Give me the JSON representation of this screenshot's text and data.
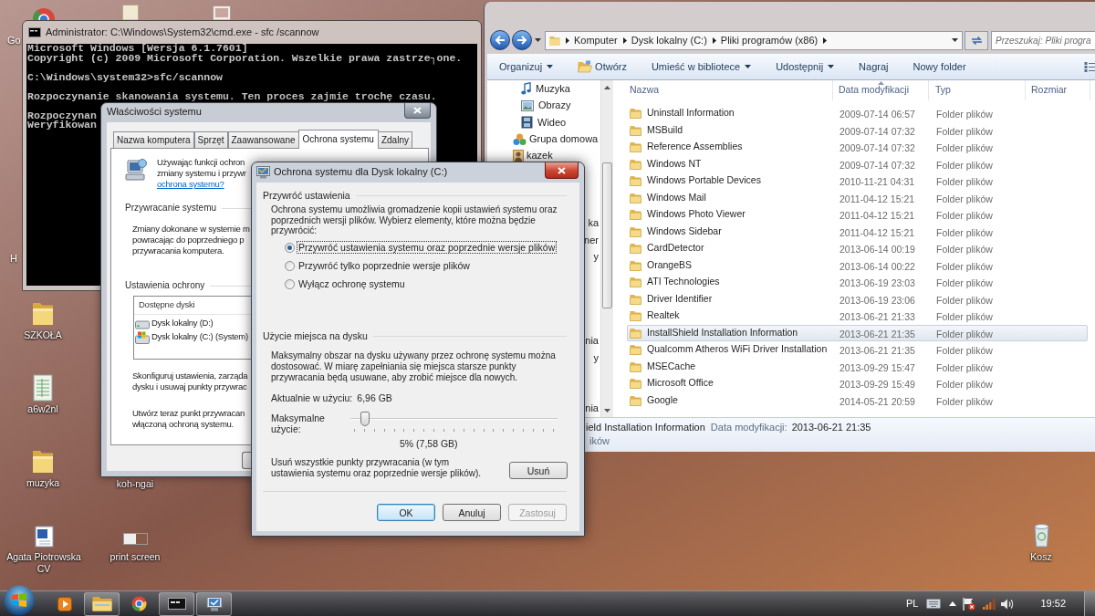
{
  "console": {
    "title": "Administrator: C:\\Windows\\System32\\cmd.exe - sfc /scannow",
    "blocks": [
      [
        "Microsoft Windows [Wersja 6.1.7601]",
        "Copyright (c) 2009 Microsoft Corporation. Wszelkie prawa zastrze┐one."
      ],
      [
        "C:\\Windows\\system32>sfc/scannow"
      ],
      [
        "Rozpoczynanie skanowania systemu. Ten proces zajmie trochę czasu."
      ],
      [
        "Rozpoczynan",
        "Weryfikowan"
      ]
    ]
  },
  "system_properties": {
    "title": "Właściwości systemu",
    "tabs": [
      {
        "label": "Nazwa komputera",
        "selected": false
      },
      {
        "label": "Sprzęt",
        "selected": false
      },
      {
        "label": "Zaawansowane",
        "selected": false
      },
      {
        "label": "Ochrona systemu",
        "selected": true
      },
      {
        "label": "Zdalny",
        "selected": false
      }
    ],
    "intro": [
      "Używając funkcji ochron",
      "zmiany systemu i przywr"
    ],
    "help_link": "ochrona systemu?",
    "sections": [
      {
        "heading": "Przywracanie systemu",
        "paragraphs": [
          [
            "Zmiany dokonane w systemie m",
            "powracając do poprzedniego p",
            "przywracania komputera."
          ]
        ]
      },
      {
        "heading": "Ustawienia ochrony",
        "drives": {
          "column": "Dostępne dyski",
          "rows": [
            {
              "name": "Dysk lokalny (D:)",
              "kind": "drive"
            },
            {
              "name": "Dysk lokalny (C:) (System)",
              "kind": "system_drive"
            }
          ]
        },
        "paragraphs": [
          [
            "Skonfiguruj ustawienia, zarząda",
            "dysku i usuwaj punkty przywrac"
          ],
          [
            "Utwórz teraz punkt przywracan",
            "włączoną ochroną systemu."
          ]
        ]
      }
    ]
  },
  "protection_dialog": {
    "title": "Ochrona systemu dla Dysk lokalny (C:)",
    "restore": {
      "heading": "Przywróć ustawienia",
      "text": "Ochrona systemu umożliwia gromadzenie kopii ustawień systemu oraz poprzednich wersji plików. Wybierz elementy, które można będzie przywrócić:",
      "options": [
        {
          "label": "Przywróć ustawienia systemu oraz poprzednie wersje plików",
          "selected": true,
          "focused": true
        },
        {
          "label": "Przywróć tylko poprzednie wersje plików",
          "selected": false,
          "focused": false
        },
        {
          "label": "Wyłącz ochronę systemu",
          "selected": false,
          "focused": false
        }
      ]
    },
    "disk_usage": {
      "heading": "Użycie miejsca na dysku",
      "text": "Maksymalny obszar na dysku używany przez ochronę systemu można dostosować. W miarę zapełniania się miejsca starsze punkty przywracania będą usuwane, aby zrobić miejsce dla nowych.",
      "current_label": "Aktualnie w użyciu:",
      "current_value": "6,96 GB",
      "max_label": "Maksymalne użycie:",
      "max_usage": {
        "level": 0.05
      },
      "max_reading": "5% (7,58 GB)",
      "delete_text": "Usuń wszystkie punkty przywracania (w tym ustawienia systemu oraz poprzednie wersje plików).",
      "delete_button": "Usuń"
    },
    "buttons": [
      {
        "label": "OK",
        "default": true,
        "disabled": false
      },
      {
        "label": "Anuluj",
        "default": false,
        "disabled": false
      },
      {
        "label": "Zastosuj",
        "default": false,
        "disabled": true
      }
    ]
  },
  "explorer": {
    "address": [
      "Komputer",
      "Dysk lokalny (C:)",
      "Pliki programów (x86)"
    ],
    "search_placeholder": "Przeszukaj: Pliki progra",
    "toolbar": [
      {
        "label": "Organizuj",
        "kind": "menu"
      },
      {
        "label": "Otwórz",
        "kind": "open"
      },
      {
        "label": "Umieść w bibliotece",
        "kind": "menu"
      },
      {
        "label": "Udostępnij",
        "kind": "menu"
      },
      {
        "label": "Nagraj",
        "kind": "plain"
      },
      {
        "label": "Nowy folder",
        "kind": "plain"
      }
    ],
    "nav": {
      "library_items": [
        {
          "label": "Muzyka",
          "kind": "music"
        },
        {
          "label": "Obrazy",
          "kind": "pictures"
        },
        {
          "label": "Wideo",
          "kind": "video"
        }
      ],
      "items": [
        {
          "label": "Grupa domowa",
          "kind": "homegroup"
        },
        {
          "label": "kazek",
          "kind": "user"
        }
      ],
      "fragments": [
        "ka",
        "ner",
        "y",
        "nia",
        "y",
        "nia"
      ]
    },
    "columns": [
      {
        "label": "Nazwa",
        "sorted": false
      },
      {
        "label": "Data modyfikacji",
        "sorted": true
      },
      {
        "label": "Typ",
        "sorted": false
      },
      {
        "label": "Rozmiar",
        "sorted": false
      }
    ],
    "rows": [
      {
        "name": "Uninstall Information",
        "date": "2009-07-14 06:57",
        "type": "Folder plików",
        "selected": false
      },
      {
        "name": "MSBuild",
        "date": "2009-07-14 07:32",
        "type": "Folder plików",
        "selected": false
      },
      {
        "name": "Reference Assemblies",
        "date": "2009-07-14 07:32",
        "type": "Folder plików",
        "selected": false
      },
      {
        "name": "Windows NT",
        "date": "2009-07-14 07:32",
        "type": "Folder plików",
        "selected": false
      },
      {
        "name": "Windows Portable Devices",
        "date": "2010-11-21 04:31",
        "type": "Folder plików",
        "selected": false
      },
      {
        "name": "Windows Mail",
        "date": "2011-04-12 15:21",
        "type": "Folder plików",
        "selected": false
      },
      {
        "name": "Windows Photo Viewer",
        "date": "2011-04-12 15:21",
        "type": "Folder plików",
        "selected": false
      },
      {
        "name": "Windows Sidebar",
        "date": "2011-04-12 15:21",
        "type": "Folder plików",
        "selected": false
      },
      {
        "name": "CardDetector",
        "date": "2013-06-14 00:19",
        "type": "Folder plików",
        "selected": false
      },
      {
        "name": "OrangeBS",
        "date": "2013-06-14 00:22",
        "type": "Folder plików",
        "selected": false
      },
      {
        "name": "ATI Technologies",
        "date": "2013-06-19 23:03",
        "type": "Folder plików",
        "selected": false
      },
      {
        "name": "Driver Identifier",
        "date": "2013-06-19 23:06",
        "type": "Folder plików",
        "selected": false
      },
      {
        "name": "Realtek",
        "date": "2013-06-21 21:33",
        "type": "Folder plików",
        "selected": false
      },
      {
        "name": "InstallShield Installation Information",
        "date": "2013-06-21 21:35",
        "type": "Folder plików",
        "selected": true
      },
      {
        "name": "Qualcomm Atheros WiFi Driver Installation",
        "date": "2013-06-21 21:35",
        "type": "Folder plików",
        "selected": false
      },
      {
        "name": "MSECache",
        "date": "2013-09-29 15:47",
        "type": "Folder plików",
        "selected": false
      },
      {
        "name": "Microsoft Office",
        "date": "2013-09-29 15:49",
        "type": "Folder plików",
        "selected": false
      },
      {
        "name": "Google",
        "date": "2014-05-21 20:59",
        "type": "Folder plików",
        "selected": false
      }
    ],
    "details": {
      "name": "ield Installation Information",
      "date_label": "Data modyfikacji:",
      "date": "2013-06-21 21:35",
      "type": "ików"
    }
  },
  "desktop": {
    "label_fragments": [
      "Go",
      "H"
    ],
    "icons": [
      {
        "label": "SZKOŁA",
        "kind": "folder"
      },
      {
        "label": "a6w2nl",
        "kind": "sheet"
      },
      {
        "label": "muzyka",
        "kind": "folder"
      },
      {
        "label": "koh-ngai",
        "kind": "covered"
      },
      {
        "label": "Agata Piotrowska CV",
        "kind": "document"
      },
      {
        "label": "print screen",
        "kind": "image"
      },
      {
        "label": "Kosz",
        "kind": "bin"
      }
    ]
  },
  "taskbar": {
    "apps": [
      {
        "kind": "media",
        "running": false
      },
      {
        "kind": "explorer",
        "running": true
      },
      {
        "kind": "browser",
        "running": false
      },
      {
        "kind": "console",
        "running": true
      },
      {
        "kind": "system",
        "running": true
      }
    ],
    "language": "PL",
    "clock": "19:52"
  }
}
